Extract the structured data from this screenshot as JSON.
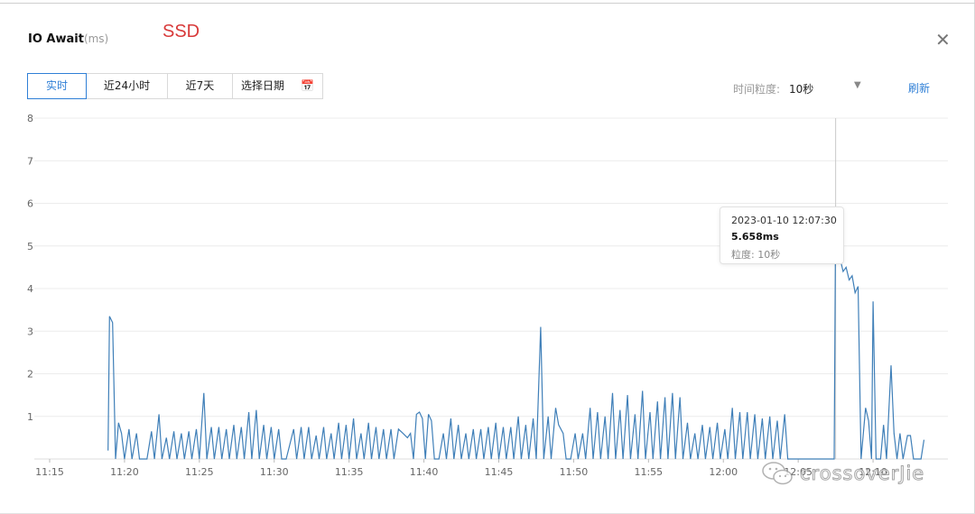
{
  "header": {
    "title": "IO Await",
    "title_unit": "(ms)",
    "annotation": "SSD",
    "close_icon": "close-icon"
  },
  "toolbar": {
    "tabs": [
      {
        "label": "实时",
        "active": true
      },
      {
        "label": "近24小时",
        "active": false
      },
      {
        "label": "近7天",
        "active": false
      },
      {
        "label": "选择日期",
        "active": false
      }
    ],
    "calendar_icon": "calendar-icon",
    "granularity_label": "时间粒度:",
    "granularity_value": "10秒",
    "refresh_label": "刷新"
  },
  "tooltip": {
    "time": "2023-01-10 12:07:30",
    "value": "5.658ms",
    "granularity": "粒度: 10秒"
  },
  "watermark": {
    "text": "crossoverJie",
    "icon": "wechat-icon"
  },
  "colors": {
    "accent": "#2f7fd6",
    "line": "#3f7fb8",
    "annotation": "#d83a3a"
  },
  "chart_data": {
    "type": "line",
    "x_ticks": [
      "11:15",
      "11:20",
      "11:25",
      "11:30",
      "11:35",
      "11:40",
      "11:45",
      "11:50",
      "11:55",
      "12:00",
      "12:05",
      "12:10"
    ],
    "y_ticks": [
      "1",
      "2",
      "3",
      "4",
      "5",
      "6",
      "7",
      "8"
    ],
    "ylim": [
      0,
      8
    ],
    "xlim_minutes": [
      0,
      60
    ],
    "grid": true,
    "highlight": {
      "x": 52.5,
      "y": 5.658
    },
    "series": [
      {
        "points": [
          [
            3.9,
            0.2
          ],
          [
            4.0,
            3.35
          ],
          [
            4.2,
            3.2
          ],
          [
            4.4,
            0.0
          ],
          [
            4.6,
            0.85
          ],
          [
            4.8,
            0.6
          ],
          [
            5.0,
            0.0
          ],
          [
            5.3,
            0.7
          ],
          [
            5.5,
            0.0
          ],
          [
            5.8,
            0.6
          ],
          [
            6.0,
            0.0
          ],
          [
            6.5,
            0.0
          ],
          [
            6.8,
            0.65
          ],
          [
            7.0,
            0.0
          ],
          [
            7.3,
            1.05
          ],
          [
            7.5,
            0.0
          ],
          [
            7.8,
            0.5
          ],
          [
            8.0,
            0.0
          ],
          [
            8.3,
            0.65
          ],
          [
            8.5,
            0.0
          ],
          [
            8.8,
            0.6
          ],
          [
            9.0,
            0.0
          ],
          [
            9.3,
            0.65
          ],
          [
            9.5,
            0.0
          ],
          [
            9.8,
            0.7
          ],
          [
            10.0,
            0.0
          ],
          [
            10.3,
            1.55
          ],
          [
            10.5,
            0.0
          ],
          [
            10.8,
            0.75
          ],
          [
            11.0,
            0.0
          ],
          [
            11.3,
            0.75
          ],
          [
            11.5,
            0.0
          ],
          [
            11.8,
            0.7
          ],
          [
            12.0,
            0.0
          ],
          [
            12.3,
            0.8
          ],
          [
            12.5,
            0.0
          ],
          [
            12.8,
            0.75
          ],
          [
            13.0,
            0.0
          ],
          [
            13.3,
            1.1
          ],
          [
            13.5,
            0.0
          ],
          [
            13.8,
            1.15
          ],
          [
            14.0,
            0.0
          ],
          [
            14.3,
            0.8
          ],
          [
            14.5,
            0.0
          ],
          [
            14.8,
            0.75
          ],
          [
            15.0,
            0.0
          ],
          [
            15.3,
            0.7
          ],
          [
            15.5,
            0.0
          ],
          [
            15.8,
            0.0
          ],
          [
            16.3,
            0.7
          ],
          [
            16.5,
            0.0
          ],
          [
            16.8,
            0.75
          ],
          [
            17.0,
            0.0
          ],
          [
            17.3,
            0.75
          ],
          [
            17.5,
            0.0
          ],
          [
            17.8,
            0.55
          ],
          [
            18.0,
            0.0
          ],
          [
            18.3,
            0.75
          ],
          [
            18.5,
            0.0
          ],
          [
            18.8,
            0.6
          ],
          [
            19.0,
            0.0
          ],
          [
            19.3,
            0.85
          ],
          [
            19.5,
            0.0
          ],
          [
            19.8,
            0.8
          ],
          [
            20.0,
            0.0
          ],
          [
            20.3,
            0.95
          ],
          [
            20.5,
            0.0
          ],
          [
            20.8,
            0.6
          ],
          [
            21.0,
            0.0
          ],
          [
            21.3,
            0.85
          ],
          [
            21.5,
            0.0
          ],
          [
            21.8,
            0.75
          ],
          [
            22.0,
            0.0
          ],
          [
            22.3,
            0.7
          ],
          [
            22.5,
            0.0
          ],
          [
            22.8,
            0.7
          ],
          [
            23.0,
            0.0
          ],
          [
            23.3,
            0.7
          ],
          [
            23.6,
            0.6
          ],
          [
            23.9,
            0.5
          ],
          [
            24.1,
            0.6
          ],
          [
            24.3,
            0.0
          ],
          [
            24.5,
            1.05
          ],
          [
            24.7,
            1.1
          ],
          [
            24.9,
            0.95
          ],
          [
            25.1,
            0.0
          ],
          [
            25.3,
            1.05
          ],
          [
            25.5,
            0.9
          ],
          [
            25.7,
            0.0
          ],
          [
            26.0,
            0.0
          ],
          [
            26.3,
            0.6
          ],
          [
            26.5,
            0.0
          ],
          [
            26.8,
            0.95
          ],
          [
            27.0,
            0.0
          ],
          [
            27.3,
            0.8
          ],
          [
            27.5,
            0.0
          ],
          [
            27.8,
            0.6
          ],
          [
            28.0,
            0.0
          ],
          [
            28.3,
            0.7
          ],
          [
            28.5,
            0.0
          ],
          [
            28.8,
            0.7
          ],
          [
            29.0,
            0.0
          ],
          [
            29.3,
            0.75
          ],
          [
            29.5,
            0.0
          ],
          [
            29.8,
            0.85
          ],
          [
            30.0,
            0.0
          ],
          [
            30.3,
            0.75
          ],
          [
            30.5,
            0.0
          ],
          [
            30.8,
            0.75
          ],
          [
            31.0,
            0.0
          ],
          [
            31.3,
            1.0
          ],
          [
            31.5,
            0.0
          ],
          [
            31.8,
            0.8
          ],
          [
            32.0,
            0.0
          ],
          [
            32.3,
            0.95
          ],
          [
            32.5,
            0.0
          ],
          [
            32.8,
            3.1
          ],
          [
            33.0,
            0.0
          ],
          [
            33.3,
            1.0
          ],
          [
            33.5,
            0.0
          ],
          [
            33.8,
            1.2
          ],
          [
            34.0,
            0.8
          ],
          [
            34.3,
            0.6
          ],
          [
            34.5,
            0.0
          ],
          [
            34.8,
            0.0
          ],
          [
            35.1,
            0.6
          ],
          [
            35.3,
            0.0
          ],
          [
            35.6,
            0.6
          ],
          [
            35.8,
            0.0
          ],
          [
            36.1,
            1.2
          ],
          [
            36.3,
            0.0
          ],
          [
            36.6,
            1.1
          ],
          [
            36.8,
            0.0
          ],
          [
            37.1,
            1.0
          ],
          [
            37.3,
            0.0
          ],
          [
            37.6,
            1.55
          ],
          [
            37.8,
            0.0
          ],
          [
            38.1,
            1.15
          ],
          [
            38.3,
            0.0
          ],
          [
            38.6,
            1.5
          ],
          [
            38.8,
            0.0
          ],
          [
            39.1,
            1.05
          ],
          [
            39.3,
            0.0
          ],
          [
            39.6,
            1.6
          ],
          [
            39.8,
            0.0
          ],
          [
            40.1,
            1.1
          ],
          [
            40.3,
            0.0
          ],
          [
            40.6,
            1.35
          ],
          [
            40.8,
            0.0
          ],
          [
            41.1,
            1.45
          ],
          [
            41.3,
            0.0
          ],
          [
            41.6,
            1.55
          ],
          [
            41.8,
            0.0
          ],
          [
            42.1,
            1.45
          ],
          [
            42.3,
            0.0
          ],
          [
            42.6,
            0.85
          ],
          [
            42.8,
            0.0
          ],
          [
            43.1,
            0.6
          ],
          [
            43.3,
            0.0
          ],
          [
            43.6,
            0.8
          ],
          [
            43.8,
            0.0
          ],
          [
            44.1,
            0.75
          ],
          [
            44.3,
            0.0
          ],
          [
            44.6,
            0.85
          ],
          [
            44.8,
            0.0
          ],
          [
            45.1,
            0.7
          ],
          [
            45.3,
            0.0
          ],
          [
            45.6,
            1.2
          ],
          [
            45.8,
            0.0
          ],
          [
            46.1,
            1.1
          ],
          [
            46.3,
            0.0
          ],
          [
            46.6,
            1.1
          ],
          [
            46.8,
            0.0
          ],
          [
            47.1,
            1.05
          ],
          [
            47.3,
            0.0
          ],
          [
            47.6,
            0.95
          ],
          [
            47.8,
            0.0
          ],
          [
            48.1,
            1.0
          ],
          [
            48.3,
            0.0
          ],
          [
            48.6,
            0.9
          ],
          [
            48.8,
            0.0
          ],
          [
            49.1,
            1.05
          ],
          [
            49.3,
            0.0
          ],
          [
            52.4,
            0.0
          ],
          [
            52.5,
            5.658
          ],
          [
            52.8,
            4.7
          ],
          [
            53.0,
            4.4
          ],
          [
            53.2,
            4.5
          ],
          [
            53.4,
            4.2
          ],
          [
            53.6,
            4.3
          ],
          [
            53.8,
            3.9
          ],
          [
            54.0,
            4.05
          ],
          [
            54.2,
            0.0
          ],
          [
            54.5,
            1.2
          ],
          [
            54.7,
            0.9
          ],
          [
            54.9,
            0.0
          ],
          [
            55.0,
            3.7
          ],
          [
            55.2,
            0.0
          ],
          [
            55.5,
            0.0
          ],
          [
            55.7,
            0.8
          ],
          [
            55.9,
            0.0
          ],
          [
            56.2,
            2.2
          ],
          [
            56.4,
            0.6
          ],
          [
            56.6,
            0.0
          ],
          [
            56.8,
            0.6
          ],
          [
            57.0,
            0.0
          ],
          [
            57.3,
            0.55
          ],
          [
            57.5,
            0.55
          ],
          [
            57.7,
            0.0
          ],
          [
            58.2,
            0.0
          ],
          [
            58.4,
            0.45
          ]
        ]
      }
    ]
  }
}
